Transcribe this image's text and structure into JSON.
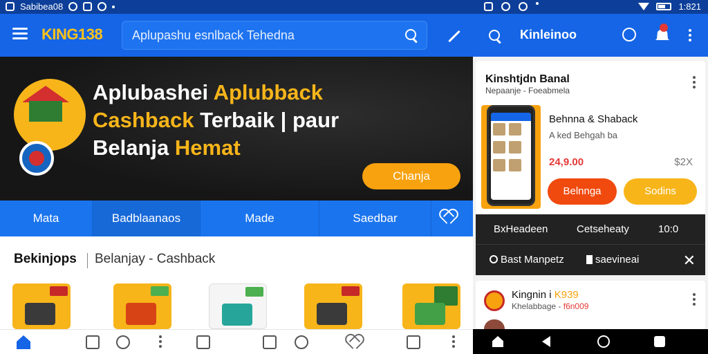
{
  "status_bar": {
    "left_text": "Sabibea08",
    "time": "1:821"
  },
  "left_app": {
    "logo": "KING138",
    "search_placeholder": "Aplupashu esnlback Tehedna",
    "banner": {
      "title_line1_white": "Aplubashei",
      "title_line1_yellow": "Aplubback",
      "title_line2_yellow": "Cashback",
      "title_line2_white": "Terbaik | paur",
      "title_line3_white": "Belanja",
      "title_line3_yellow": "Hemat",
      "button_label": "Chanja"
    },
    "tabs": [
      {
        "label": "Mata"
      },
      {
        "label": "Badblaanaos"
      },
      {
        "label": "Made"
      },
      {
        "label": "Saedbar"
      }
    ],
    "section": {
      "title": "Bekinjops",
      "subtitle": "Belanjay - Cashback"
    }
  },
  "right_app": {
    "title": "Kinleinoo",
    "card": {
      "title": "Kinshtjdn Banal",
      "subtitle": "Nepaanje - Foeabmela",
      "product_name": "Behnna & Shaback",
      "product_desc": "A ked Behgah ba",
      "price": "24,9.00",
      "price_alt": "$2X",
      "buy_label": "Belnnga",
      "save_label": "Sodins"
    },
    "dark_menu": {
      "row1": [
        "BxHeadeen",
        "Cetseheaty",
        "10:0"
      ],
      "row2": [
        "Bast Manpetz",
        "saevineai"
      ]
    },
    "card2": {
      "title_prefix": "Kingnin i",
      "title_highlight": "K939",
      "subtitle_prefix": "Khelabbage -",
      "subtitle_highlight": "f6n009"
    }
  }
}
